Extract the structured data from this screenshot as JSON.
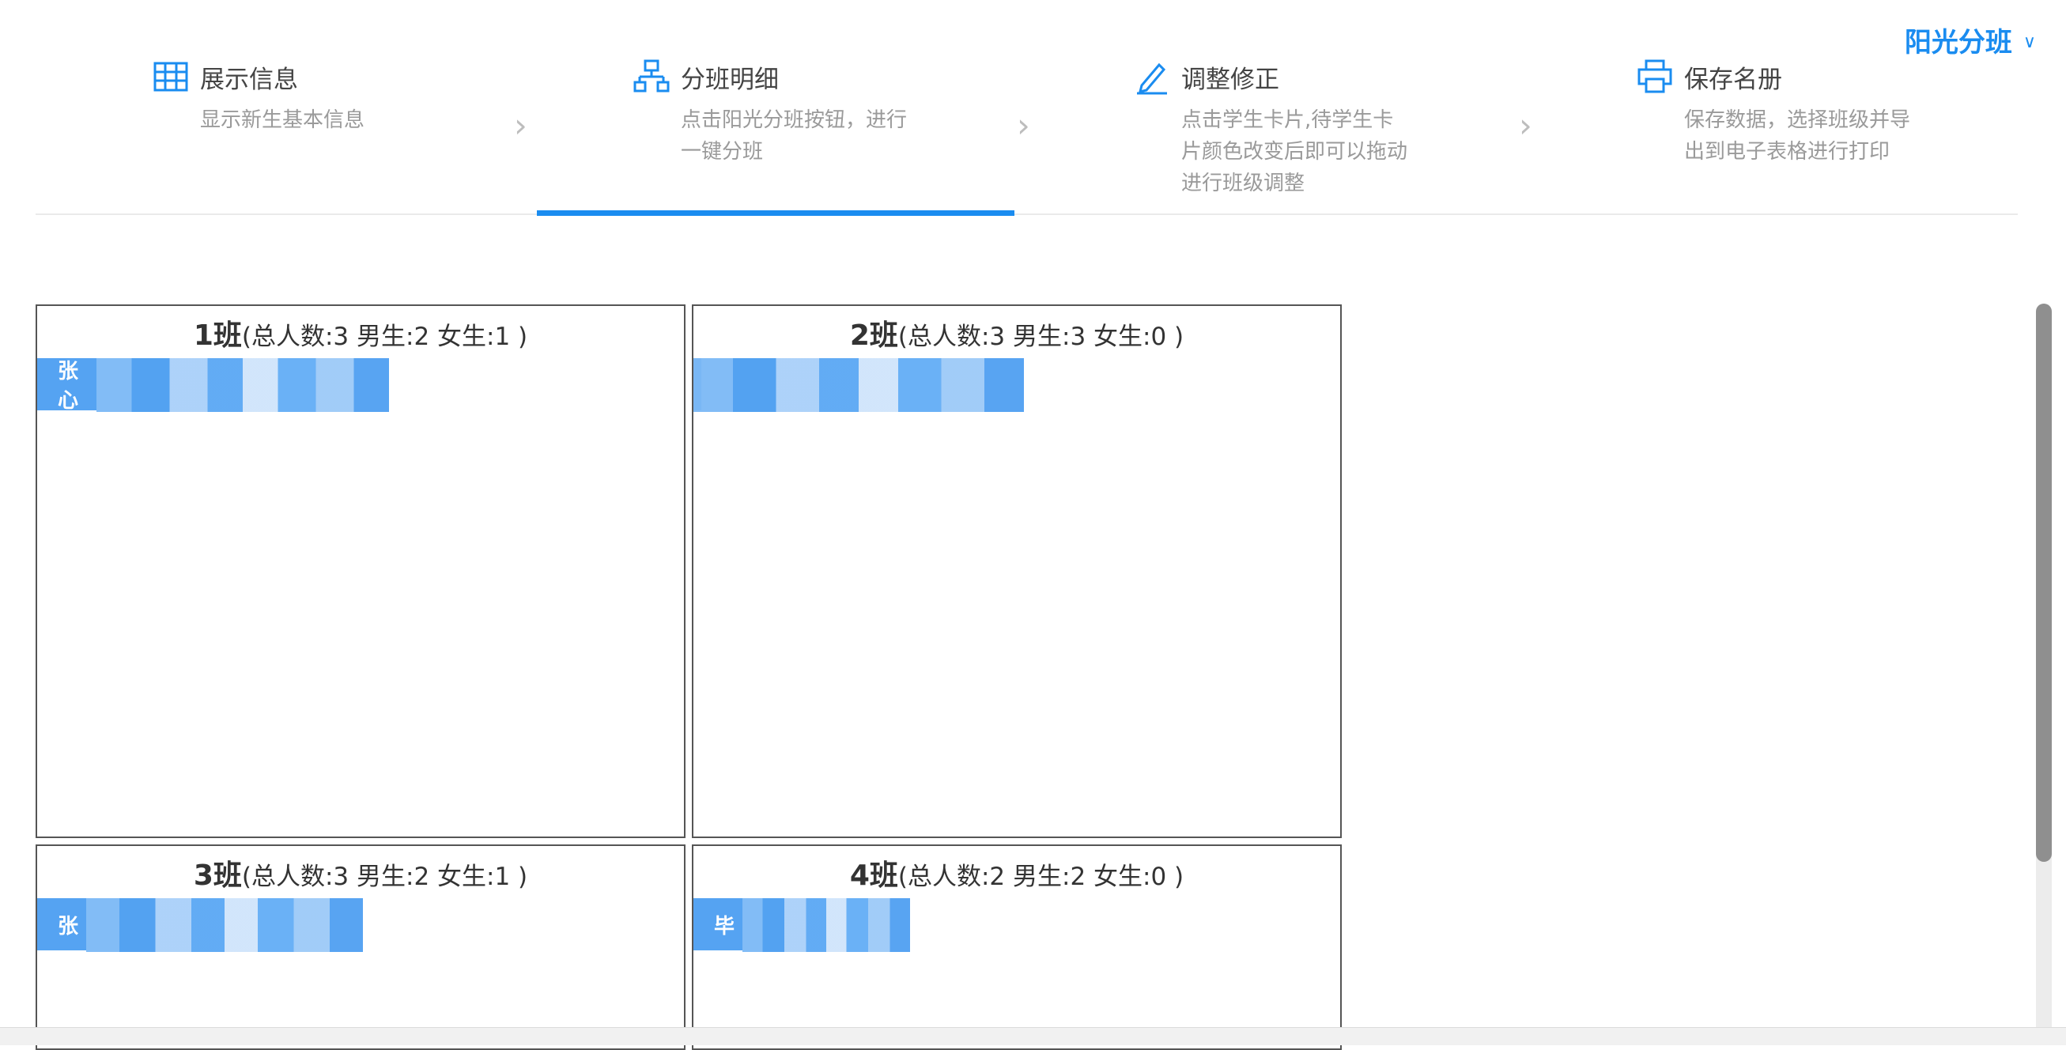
{
  "header": {
    "brand_label": "阳光分班",
    "brand_chevron": "∨"
  },
  "steps": [
    {
      "title": "展示信息",
      "desc": "显示新生基本信息",
      "icon": "table-grid-icon"
    },
    {
      "title": "分班明细",
      "desc": "点击阳光分班按钮，进行一键分班",
      "icon": "org-chart-icon"
    },
    {
      "title": "调整修正",
      "desc": "点击学生卡片,待学生卡片颜色改变后即可以拖动进行班级调整",
      "icon": "pencil-icon"
    },
    {
      "title": "保存名册",
      "desc": "保存数据，选择班级并导出到电子表格进行打印",
      "icon": "printer-icon"
    }
  ],
  "arrow_glyph": "›",
  "classes": [
    {
      "name": "1班",
      "stats": "(总人数:3 男生:2 女生:1 )",
      "first_card": "张心"
    },
    {
      "name": "2班",
      "stats": "(总人数:3 男生:3 女生:0 )",
      "first_card": ""
    },
    {
      "name": "3班",
      "stats": "(总人数:3 男生:2 女生:1 )",
      "first_card": "张"
    },
    {
      "name": "4班",
      "stats": "(总人数:2 男生:2 女生:0 )",
      "first_card": "毕"
    }
  ],
  "colors": {
    "accent": "#1a8cf0",
    "card": "#55a3f2"
  }
}
